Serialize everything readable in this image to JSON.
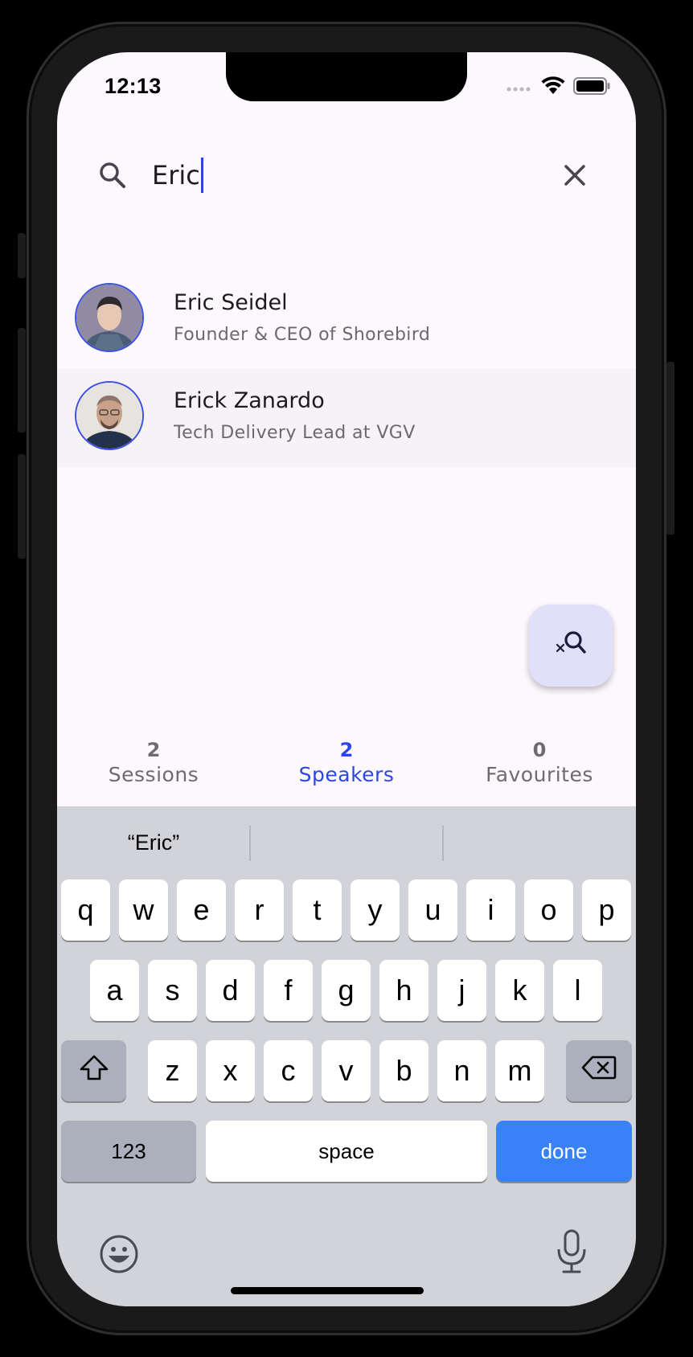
{
  "status": {
    "time": "12:13"
  },
  "search": {
    "query": "Eric"
  },
  "results": [
    {
      "name": "Eric Seidel",
      "role": "Founder & CEO of Shorebird"
    },
    {
      "name": "Erick Zanardo",
      "role": "Tech Delivery Lead at VGV"
    }
  ],
  "tabs": [
    {
      "count": "2",
      "label": "Sessions",
      "active": false
    },
    {
      "count": "2",
      "label": "Speakers",
      "active": true
    },
    {
      "count": "0",
      "label": "Favourites",
      "active": false
    }
  ],
  "keyboard": {
    "suggestions": [
      "“Eric”",
      "",
      ""
    ],
    "row1": [
      "q",
      "w",
      "e",
      "r",
      "t",
      "y",
      "u",
      "i",
      "o",
      "p"
    ],
    "row2": [
      "a",
      "s",
      "d",
      "f",
      "g",
      "h",
      "j",
      "k",
      "l"
    ],
    "row3": [
      "z",
      "x",
      "c",
      "v",
      "b",
      "n",
      "m"
    ],
    "numbers_label": "123",
    "space_label": "space",
    "done_label": "done"
  },
  "colors": {
    "accent": "#2c46e2",
    "done_key": "#3881f7",
    "fab_bg": "#e1e0fb"
  }
}
